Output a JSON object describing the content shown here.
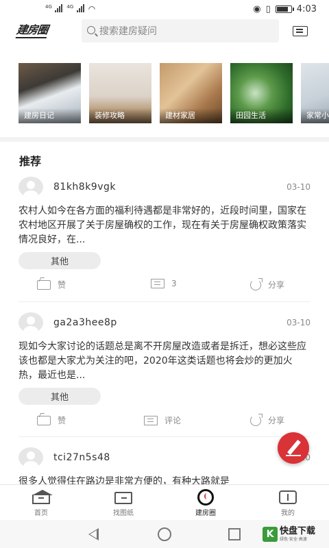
{
  "status_bar": {
    "sig1_label": "4G",
    "sig2_label": "4G",
    "time": "4:03",
    "battery_level": 0.85
  },
  "header": {
    "logo": "建房圈",
    "search_placeholder": "搜索建房疑问"
  },
  "categories": [
    {
      "label": "建房日记"
    },
    {
      "label": "装修攻略"
    },
    {
      "label": "建材家居"
    },
    {
      "label": "田园生活"
    },
    {
      "label": "家常小"
    }
  ],
  "section_title": "推荐",
  "posts": [
    {
      "username": "81kh8k9vgk",
      "date": "03-10",
      "text": "农村人如今在各方面的福利待遇都是非常好的，近段时间里，国家在农村地区开展了关于房屋确权的工作，现在有关于房屋确权政策落实情况良好，在...",
      "tag": "其他",
      "like_label": "赞",
      "comment_label": "3",
      "share_label": "分享"
    },
    {
      "username": "ga2a3hee8p",
      "date": "03-10",
      "text": "现如今大家讨论的话题总是离不开房屋改造或者是拆迁，想必这些应该也都是大家尤为关注的吧，2020年这类话题也将会炒的更加火热，最近也是...",
      "tag": "其他",
      "like_label": "赞",
      "comment_label": "评论",
      "share_label": "分享"
    },
    {
      "username": "tci27n5s48",
      "date": "03-10",
      "text": "很多人觉得住在路边是非常方便的，有种大路就是"
    }
  ],
  "bottom_nav": [
    {
      "label": "首页"
    },
    {
      "label": "找图纸"
    },
    {
      "label": "建房圈"
    },
    {
      "label": "我的"
    }
  ],
  "watermark": {
    "glyph": "K",
    "name": "快盘下载",
    "sub": "绿色·安全·高速"
  },
  "colors": {
    "accent": "#d93237",
    "watermark_green": "#3a9c3a"
  }
}
